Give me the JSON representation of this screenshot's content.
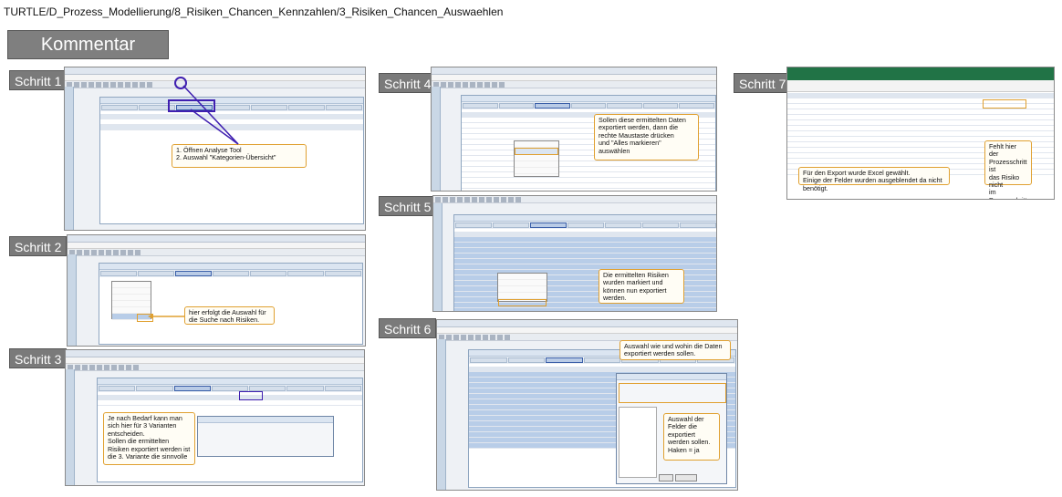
{
  "path": "TURTLE/D_Prozess_Modellierung/8_Risiken_Chancen_Kennzahlen/3_Risiken_Chancen_Auswaehlen",
  "kommentar": "Kommentar",
  "steps": [
    {
      "label": "Schritt 1",
      "note": "1. Öffnen Analyse Tool\n2. Auswahl \"Kategorien-Übersicht\""
    },
    {
      "label": "Schritt 2",
      "note": "hier erfolgt die Auswahl für\ndie Suche nach Risiken."
    },
    {
      "label": "Schritt 3",
      "note": "Je nach Bedarf kann man\nsich hier für 3 Varianten\nentscheiden.\nSollen die ermittelten\nRisiken exportiert werden ist\ndie 3. Variante die sinnvolle"
    },
    {
      "label": "Schritt 4",
      "note": "Sollen diese ermittelten Daten\nexportiert werden, dann die\nrechte Maustaste drücken\nund \"Alles markieren\"\nauswählen"
    },
    {
      "label": "Schritt 5",
      "note": "Die ermittelten Risiken\nwurden markiert und\nkönnen nun exportiert\nwerden."
    },
    {
      "label": "Schritt 6",
      "note": "Auswahl wie und wohin die Daten\nexportiert werden sollen.",
      "note2": "Auswahl der\nFelder die\nexportiert\nwerden sollen.\nHaken = ja"
    },
    {
      "label": "Schritt 7",
      "note": "Für den Export wurde Excel gewählt.\nEinige der Felder wurden ausgeblendet da nicht benötigt.",
      "note2": "Fehlt hier der\nProzesschritt ist\ndas Risiko nicht\nim Prozesschritt\nsondern im\nProzess"
    }
  ]
}
